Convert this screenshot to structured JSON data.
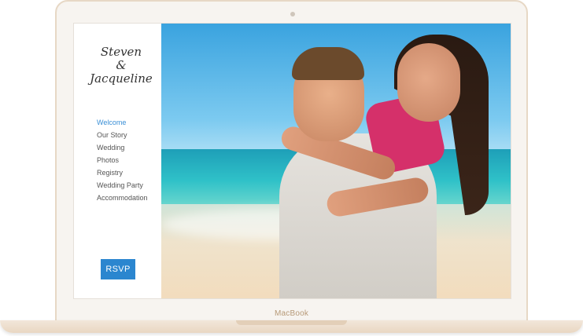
{
  "laptop": {
    "label": "MacBook"
  },
  "site": {
    "brand_line1": "Steven",
    "brand_line2": "&",
    "brand_line3": "Jacqueline",
    "nav": [
      "Welcome",
      "Our Story",
      "Wedding",
      "Photos",
      "Registry",
      "Wedding Party",
      "Accommodation"
    ],
    "active_nav": "Welcome",
    "rsvp_label": "RSVP",
    "accent_color": "#2b86cf"
  }
}
